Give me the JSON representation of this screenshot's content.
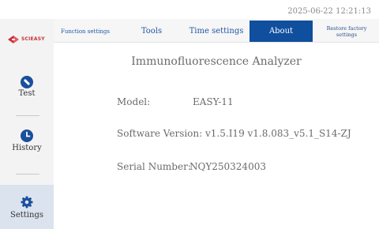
{
  "status_bar": {
    "datetime": "2025-06-22 12:21:13"
  },
  "logo": {
    "text": "SCIEASY"
  },
  "sidebar": {
    "items": [
      {
        "label": "Test",
        "icon": "test-icon"
      },
      {
        "label": "History",
        "icon": "clock-icon"
      },
      {
        "label": "Settings",
        "icon": "gear-icon",
        "selected": true
      }
    ]
  },
  "tabs": [
    {
      "label": "Function settings"
    },
    {
      "label": "Tools"
    },
    {
      "label": "Time settings"
    },
    {
      "label": "About",
      "active": true
    },
    {
      "label": "Restore factory settings"
    }
  ],
  "about": {
    "title": "Immunofluorescence Analyzer",
    "model_label": "Model:",
    "model_value": "EASY-11",
    "software_label": "Software Version:",
    "software_value": "v1.5.I19 v1.8.083_v5.1_S14-ZJ",
    "serial_label": "Serial Number:",
    "serial_value": "NQY250324003"
  },
  "colors": {
    "accent": "#0f4f9e",
    "icon_blue": "#1a4f9c",
    "logo_red": "#c8313a",
    "selected_nav_bg": "#dbe3ef"
  }
}
